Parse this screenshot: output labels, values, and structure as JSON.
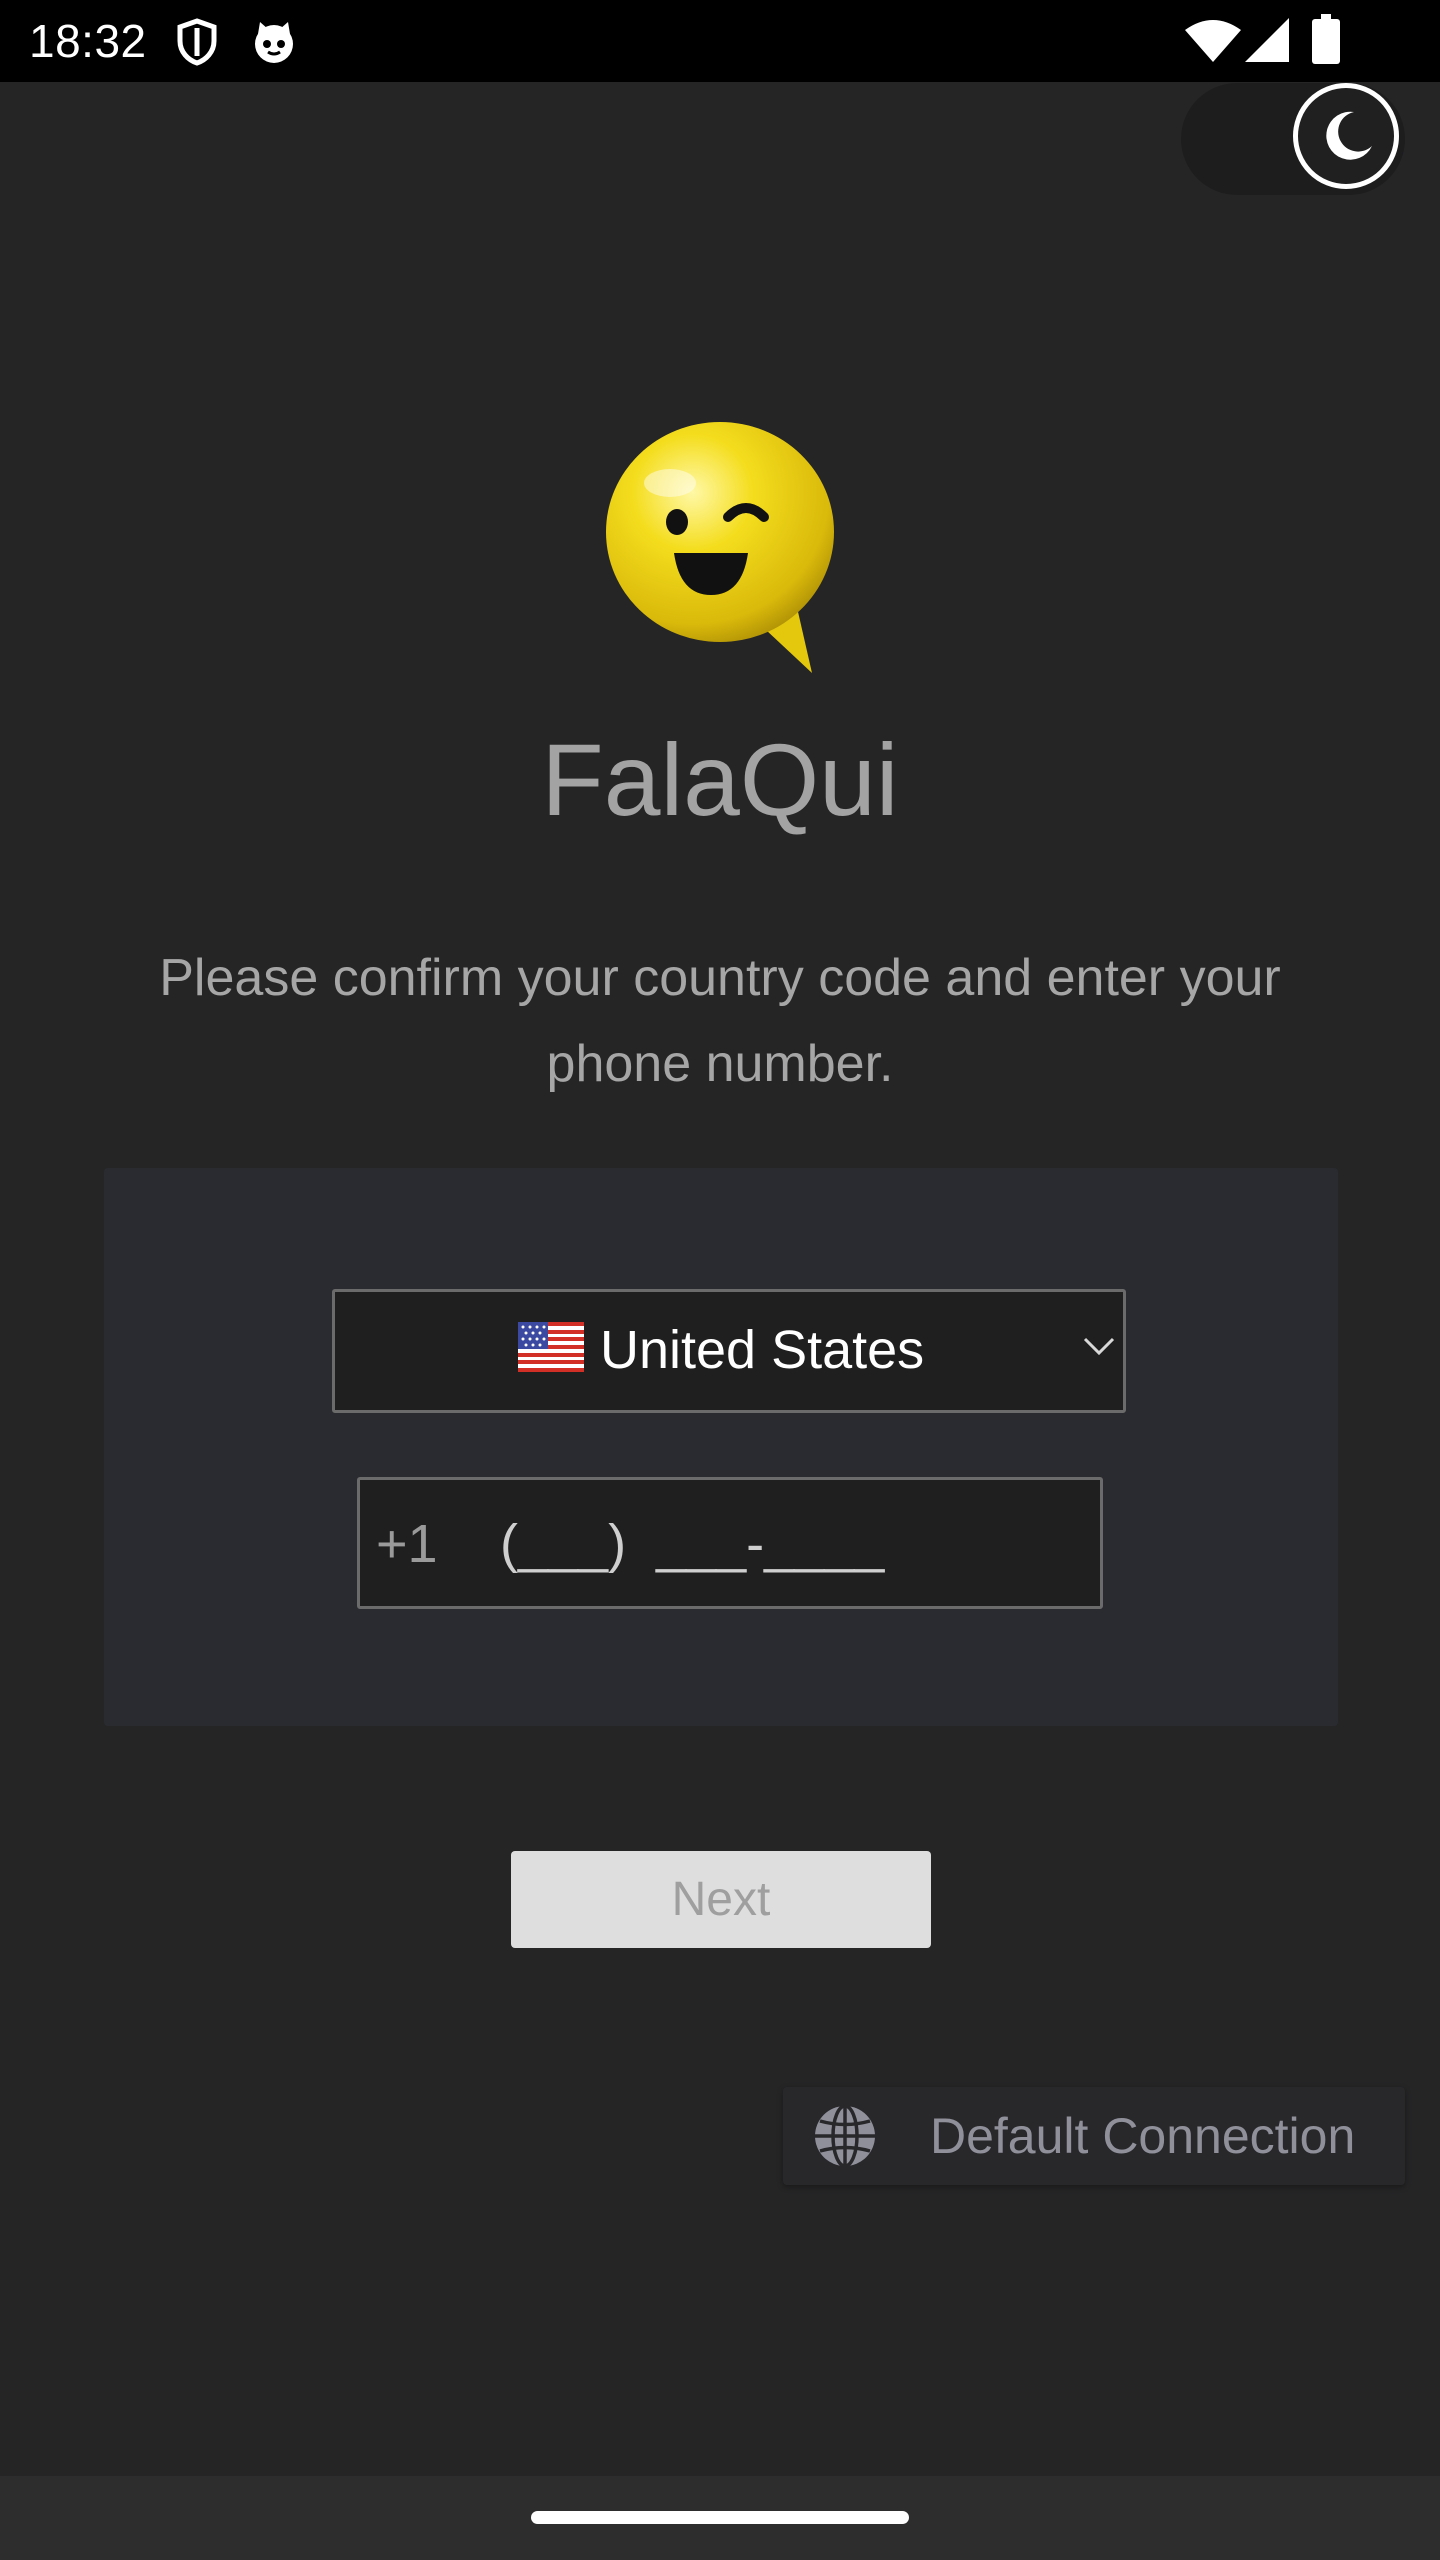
{
  "status_bar": {
    "time": "18:32",
    "icons": [
      "shield-icon",
      "cat-icon",
      "wifi-icon",
      "signal-icon",
      "battery-icon"
    ]
  },
  "theme_toggle": {
    "icon": "moon-icon",
    "state": "dark"
  },
  "app": {
    "name": "FalaQui",
    "logo_icon": "winking-speech-bubble-icon"
  },
  "login": {
    "instructions": "Please confirm your country code and enter your phone number.",
    "country": {
      "flag_icon": "us-flag-icon",
      "selected": "United States"
    },
    "phone": {
      "prefix": "+1",
      "mask": "(___)  ___-____"
    },
    "next_label": "Next"
  },
  "connection": {
    "icon": "globe-icon",
    "label": "Default Connection"
  },
  "colors": {
    "background": "#252526",
    "card": "#2a2b31",
    "button_disabled_bg": "#dedede",
    "button_disabled_text": "#9f9f9f",
    "logo_yellow": "#f2d70f"
  }
}
